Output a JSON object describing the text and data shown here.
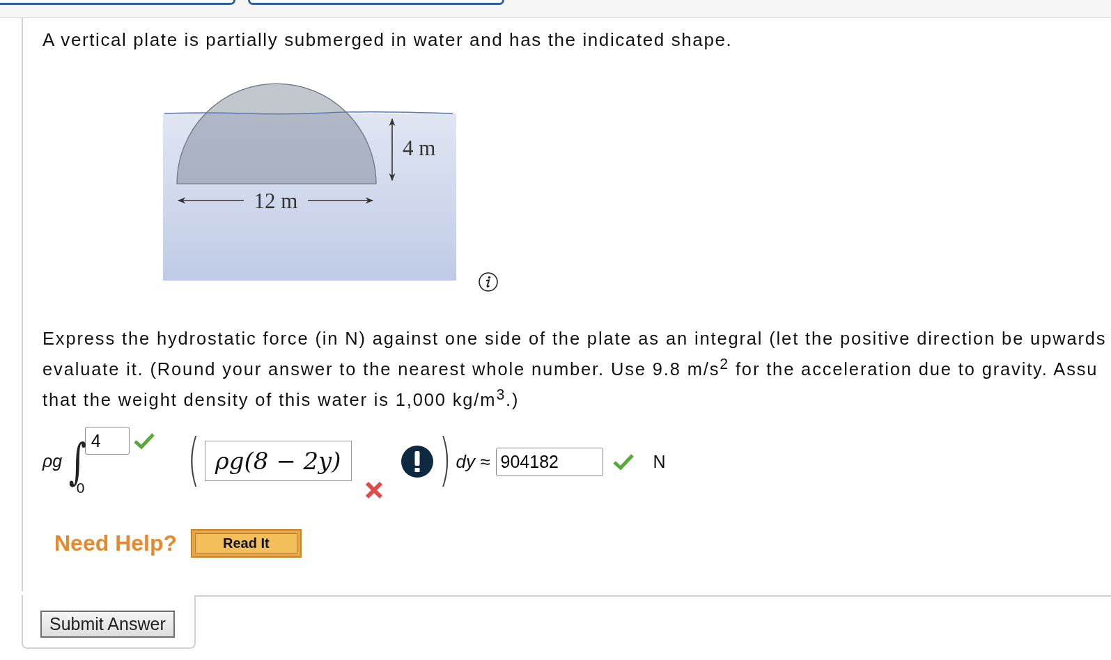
{
  "intro": "A vertical plate is partially submerged in water and has the indicated shape.",
  "figure": {
    "height_label": "4 m",
    "width_label": "12 m"
  },
  "question_lines": [
    "Express the hydrostatic force (in N) against one side of the plate as an integral (let the positive direction be upwards",
    "evaluate it. (Round your answer to the nearest whole number. Use 9.8 m/s$^{2}$ for the acceleration due to gravity. Assu",
    "that the weight density of this water is 1,000 kg/m$^{3}$.)"
  ],
  "integral": {
    "prefix": "ρg",
    "sign": "∫",
    "upper_limit": {
      "value": "4",
      "correct": true
    },
    "lower_limit": "0",
    "open_paren": "(",
    "integrand": {
      "value": "ρg(8 − 2y)",
      "correct": false
    },
    "close_paren": ")",
    "differential": "dy ≈",
    "result": {
      "value": "904182",
      "correct": true
    },
    "unit": "N"
  },
  "help": {
    "label": "Need Help?",
    "buttons": [
      "Read It"
    ]
  },
  "submit": "Submit Answer"
}
